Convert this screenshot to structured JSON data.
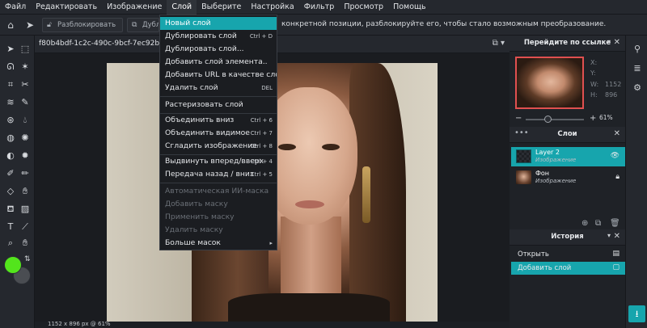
{
  "menubar": {
    "items": [
      "Файл",
      "Редактировать",
      "Изображение",
      "Слой",
      "Выберите",
      "Настройка",
      "Фильтр",
      "Просмотр",
      "Помощь"
    ],
    "active_index": 3
  },
  "options_bar": {
    "unlock_label": "Разблокировать",
    "duplicate_label": "Дубл",
    "hint": "конкретной позиции, разблокируйте его, чтобы стало возможным преобразование."
  },
  "document": {
    "tab_title": "f80b4bdf-1c2c-490c-9bcf-7ec92be3eb..",
    "status": "1152 x 896 px @ 61%"
  },
  "layer_menu": {
    "items": [
      {
        "label": "Новый слой",
        "shortcut": "",
        "state": "highlighted"
      },
      {
        "label": "Дублировать слой",
        "shortcut": "Ctrl + D",
        "state": "enabled"
      },
      {
        "label": "Дублировать слой...",
        "shortcut": "",
        "state": "enabled"
      },
      {
        "label": "Добавить слой элемента..",
        "shortcut": "",
        "state": "enabled"
      },
      {
        "label": "Добавить URL в качестве слоя..",
        "shortcut": "",
        "state": "enabled"
      },
      {
        "label": "Удалить слой",
        "shortcut": "DEL",
        "state": "enabled"
      },
      {
        "label": "Растеризовать слой",
        "shortcut": "",
        "state": "enabled"
      },
      {
        "label": "Объединить вниз",
        "shortcut": "Ctrl + 6",
        "state": "enabled"
      },
      {
        "label": "Объединить видимое",
        "shortcut": "Ctrl + 7",
        "state": "enabled"
      },
      {
        "label": "Сгладить изображение",
        "shortcut": "Ctrl + 8",
        "state": "enabled"
      },
      {
        "label": "Выдвинуть вперед/вверх",
        "shortcut": "Ctrl + 4",
        "state": "enabled"
      },
      {
        "label": "Передача назад / вниз",
        "shortcut": "Ctrl + 5",
        "state": "enabled"
      },
      {
        "label": "Автоматическая ИИ-маска",
        "shortcut": "",
        "state": "disabled"
      },
      {
        "label": "Добавить маску",
        "shortcut": "",
        "state": "disabled"
      },
      {
        "label": "Применить маску",
        "shortcut": "",
        "state": "disabled"
      },
      {
        "label": "Удалить маску",
        "shortcut": "",
        "state": "disabled"
      },
      {
        "label": "Больше масок",
        "shortcut": "▸",
        "state": "enabled"
      }
    ]
  },
  "navigator": {
    "title": "Перейдите по ссылке",
    "x_label": "X:",
    "y_label": "Y:",
    "w_label": "W:",
    "w_value": "1152",
    "h_label": "H:",
    "h_value": "896",
    "zoom_value": "61%",
    "zoom_level": 0.61
  },
  "layers": {
    "title": "Слои",
    "items": [
      {
        "name": "Layer 2",
        "type": "Изображение",
        "selected": true,
        "icon": "eye-icon"
      },
      {
        "name": "Фон",
        "type": "Изображение",
        "selected": false,
        "icon": "lock-icon"
      }
    ]
  },
  "history": {
    "title": "История",
    "items": [
      {
        "name": "Открыть",
        "selected": false
      },
      {
        "name": "Добавить слой",
        "selected": true
      }
    ]
  },
  "colors": {
    "accent": "#17a5ad",
    "foreground": "#53e51c",
    "background": "#4a4d52"
  }
}
